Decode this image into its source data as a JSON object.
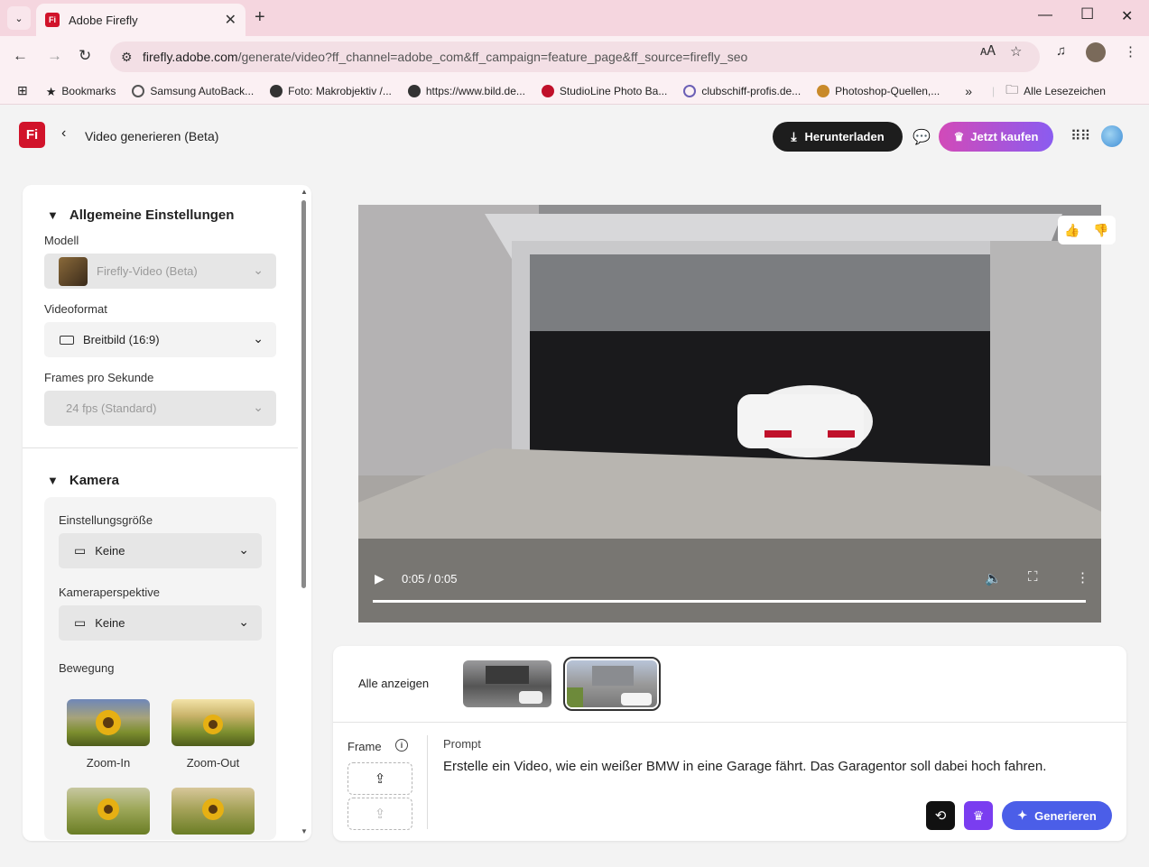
{
  "browser": {
    "tab_title": "Adobe Firefly",
    "tab_favicon": "Fi",
    "url_main": "firefly.adobe.com",
    "url_rest": "/generate/video?ff_channel=adobe_com&ff_campaign=feature_page&ff_source=firefly_seo",
    "bookmarks": [
      {
        "label": "Bookmarks",
        "icon": "star-icon",
        "color": "#222"
      },
      {
        "label": "Samsung AutoBack...",
        "icon": "samsung-icon",
        "color": "#555"
      },
      {
        "label": "Foto: Makrobjektiv /...",
        "icon": "globe-icon",
        "color": "#333"
      },
      {
        "label": "https://www.bild.de...",
        "icon": "globe-icon",
        "color": "#333"
      },
      {
        "label": "StudioLine Photo Ba...",
        "icon": "studioline-icon",
        "color": "#c0102a"
      },
      {
        "label": "clubschiff-profis.de...",
        "icon": "club-icon",
        "color": "#6b5fb5"
      },
      {
        "label": "Photoshop-Quellen,...",
        "icon": "owl-icon",
        "color": "#c98a2a"
      }
    ],
    "more_bookmarks": "»",
    "all_bookmarks": "Alle Lesezeichen"
  },
  "header": {
    "logo": "Fi",
    "title": "Video generieren (Beta)",
    "download_label": "Herunterladen",
    "buy_label": "Jetzt kaufen"
  },
  "settings": {
    "general_title": "Allgemeine Einstellungen",
    "model_label": "Modell",
    "model_value": "Firefly-Video (Beta)",
    "format_label": "Videoformat",
    "format_value": "Breitbild (16:9)",
    "fps_label": "Frames pro Sekunde",
    "fps_value": "24 fps (Standard)",
    "camera_title": "Kamera",
    "shot_label": "Einstellungsgröße",
    "shot_value": "Keine",
    "angle_label": "Kameraperspektive",
    "angle_value": "Keine",
    "motion_label": "Bewegung",
    "motions": [
      "Zoom-In",
      "Zoom-Out"
    ]
  },
  "video": {
    "time": "0:05 / 0:05"
  },
  "generation": {
    "show_all": "Alle anzeigen",
    "frame_label": "Frame",
    "prompt_label": "Prompt",
    "prompt_text": "Erstelle ein Video, wie ein weißer BMW in eine Garage fährt. Das Garagentor soll dabei hoch fahren.",
    "generate_label": "Generieren"
  }
}
